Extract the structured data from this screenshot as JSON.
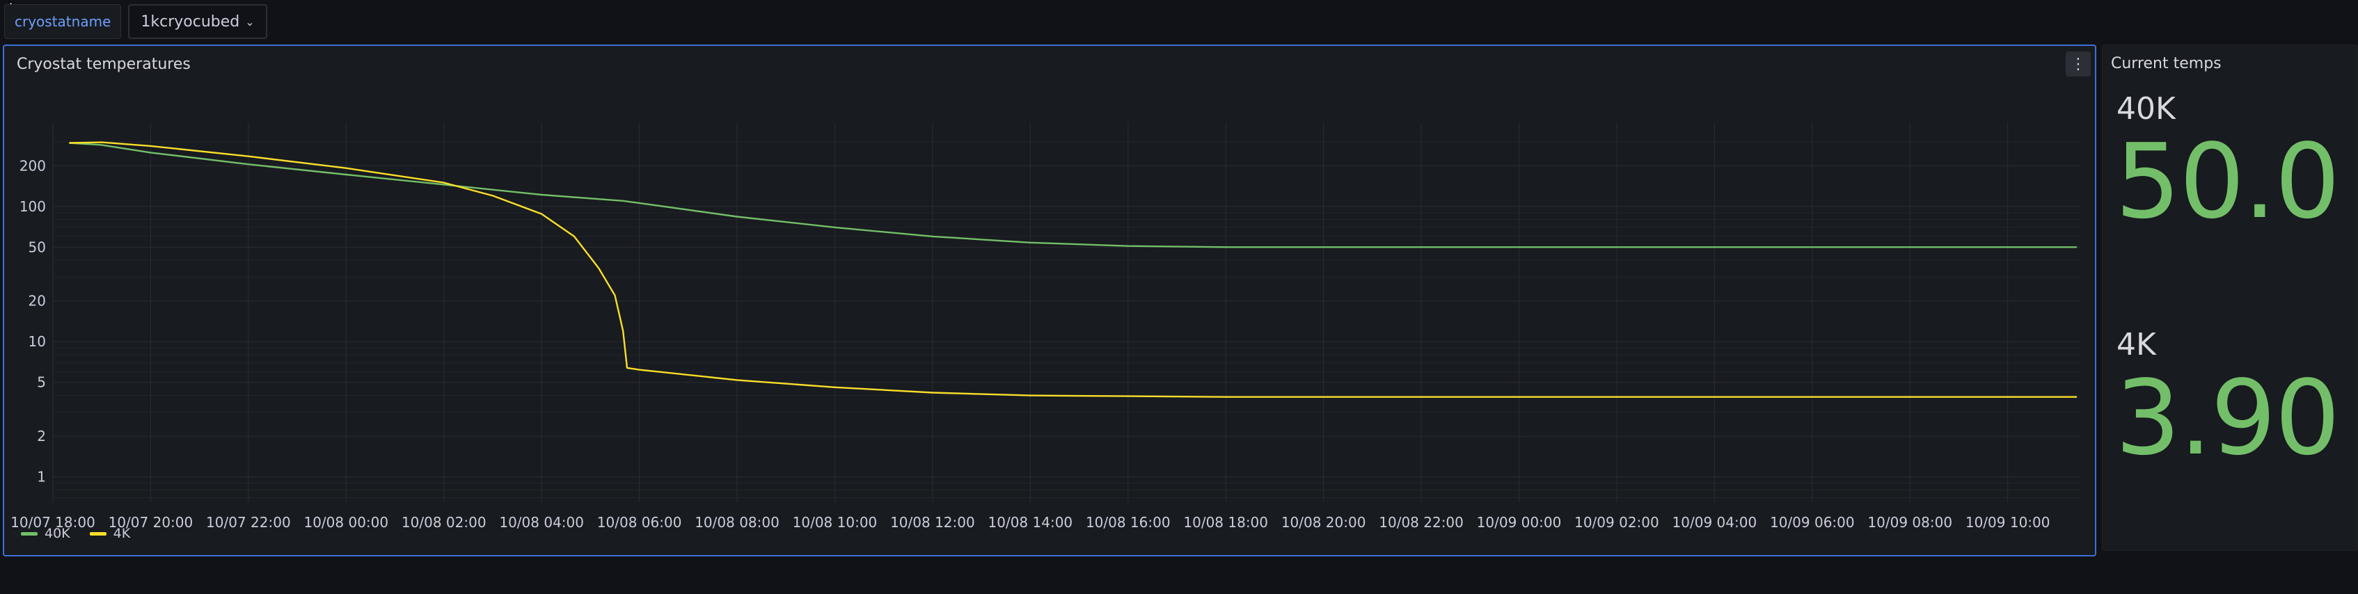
{
  "variables": {
    "label": "cryostatname",
    "value": "1kcryocubed"
  },
  "chart_panel": {
    "title": "Cryostat temperatures",
    "menu_icon": "kebab-menu-icon"
  },
  "stat_panel": {
    "title": "Current temps",
    "stats": [
      {
        "label": "40K",
        "value": "50.0"
      },
      {
        "label": "4K",
        "value": "3.90"
      }
    ],
    "value_color": "#73bf69"
  },
  "chart_data": {
    "type": "line",
    "yscale": "log",
    "ylim": [
      0.65,
      330
    ],
    "y_ticks": [
      1,
      2,
      5,
      10,
      20,
      50,
      100,
      200
    ],
    "x_ticks": [
      "10/07 18:00",
      "10/07 20:00",
      "10/07 22:00",
      "10/08 00:00",
      "10/08 02:00",
      "10/08 04:00",
      "10/08 06:00",
      "10/08 08:00",
      "10/08 10:00",
      "10/08 12:00",
      "10/08 14:00",
      "10/08 16:00",
      "10/08 18:00",
      "10/08 20:00",
      "10/08 22:00",
      "10/09 00:00",
      "10/09 02:00",
      "10/09 04:00",
      "10/09 06:00",
      "10/09 08:00",
      "10/09 10:00"
    ],
    "xlim": [
      "10/07 18:00",
      "10/09 11:30"
    ],
    "grid": true,
    "legend_position": "bottom-left",
    "series": [
      {
        "name": "40K",
        "color": "#73bf69",
        "points": [
          [
            "10/07 18:20",
            295
          ],
          [
            "10/07 19:00",
            285
          ],
          [
            "10/07 20:00",
            250
          ],
          [
            "10/07 22:00",
            205
          ],
          [
            "10/08 00:00",
            172
          ],
          [
            "10/08 02:00",
            145
          ],
          [
            "10/08 04:00",
            122
          ],
          [
            "10/08 05:40",
            110
          ],
          [
            "10/08 06:00",
            106
          ],
          [
            "10/08 08:00",
            84
          ],
          [
            "10/08 10:00",
            70
          ],
          [
            "10/08 12:00",
            60
          ],
          [
            "10/08 14:00",
            54
          ],
          [
            "10/08 16:00",
            51
          ],
          [
            "10/08 18:00",
            50
          ],
          [
            "10/08 22:00",
            50
          ],
          [
            "10/09 02:00",
            50
          ],
          [
            "10/09 06:00",
            50
          ],
          [
            "10/09 10:00",
            50
          ],
          [
            "10/09 11:25",
            50
          ]
        ]
      },
      {
        "name": "4K",
        "color": "#fade2a",
        "points": [
          [
            "10/07 18:20",
            295
          ],
          [
            "10/07 19:00",
            298
          ],
          [
            "10/07 20:00",
            280
          ],
          [
            "10/07 22:00",
            235
          ],
          [
            "10/08 00:00",
            192
          ],
          [
            "10/08 02:00",
            150
          ],
          [
            "10/08 03:00",
            120
          ],
          [
            "10/08 04:00",
            88
          ],
          [
            "10/08 04:40",
            60
          ],
          [
            "10/08 05:10",
            35
          ],
          [
            "10/08 05:30",
            22
          ],
          [
            "10/08 05:40",
            12
          ],
          [
            "10/08 05:45",
            6.4
          ],
          [
            "10/08 06:00",
            6.2
          ],
          [
            "10/08 08:00",
            5.2
          ],
          [
            "10/08 10:00",
            4.6
          ],
          [
            "10/08 12:00",
            4.2
          ],
          [
            "10/08 14:00",
            4.0
          ],
          [
            "10/08 16:00",
            3.95
          ],
          [
            "10/08 18:00",
            3.9
          ],
          [
            "10/08 22:00",
            3.9
          ],
          [
            "10/09 02:00",
            3.9
          ],
          [
            "10/09 06:00",
            3.9
          ],
          [
            "10/09 10:00",
            3.9
          ],
          [
            "10/09 11:25",
            3.9
          ]
        ]
      }
    ]
  }
}
